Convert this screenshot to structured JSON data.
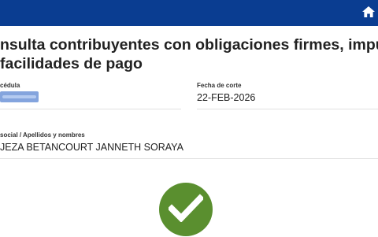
{
  "header": {
    "home_icon": "home-icon",
    "bar_color": "#0a3d91"
  },
  "page": {
    "title_line1": "nsulta contribuyentes con obligaciones firmes, impugnadas",
    "title_line2": "facilidades de pago"
  },
  "fields": {
    "cedula_label": "cédula",
    "fecha_label": "Fecha de corte",
    "fecha_value": "22-FEB-2026",
    "razon_label": "social / Apellidos y nombres",
    "razon_value": "JEZA BETANCOURT JANNETH SORAYA"
  },
  "status": {
    "icon": "check-circle-icon",
    "color": "#5a8f2f"
  }
}
